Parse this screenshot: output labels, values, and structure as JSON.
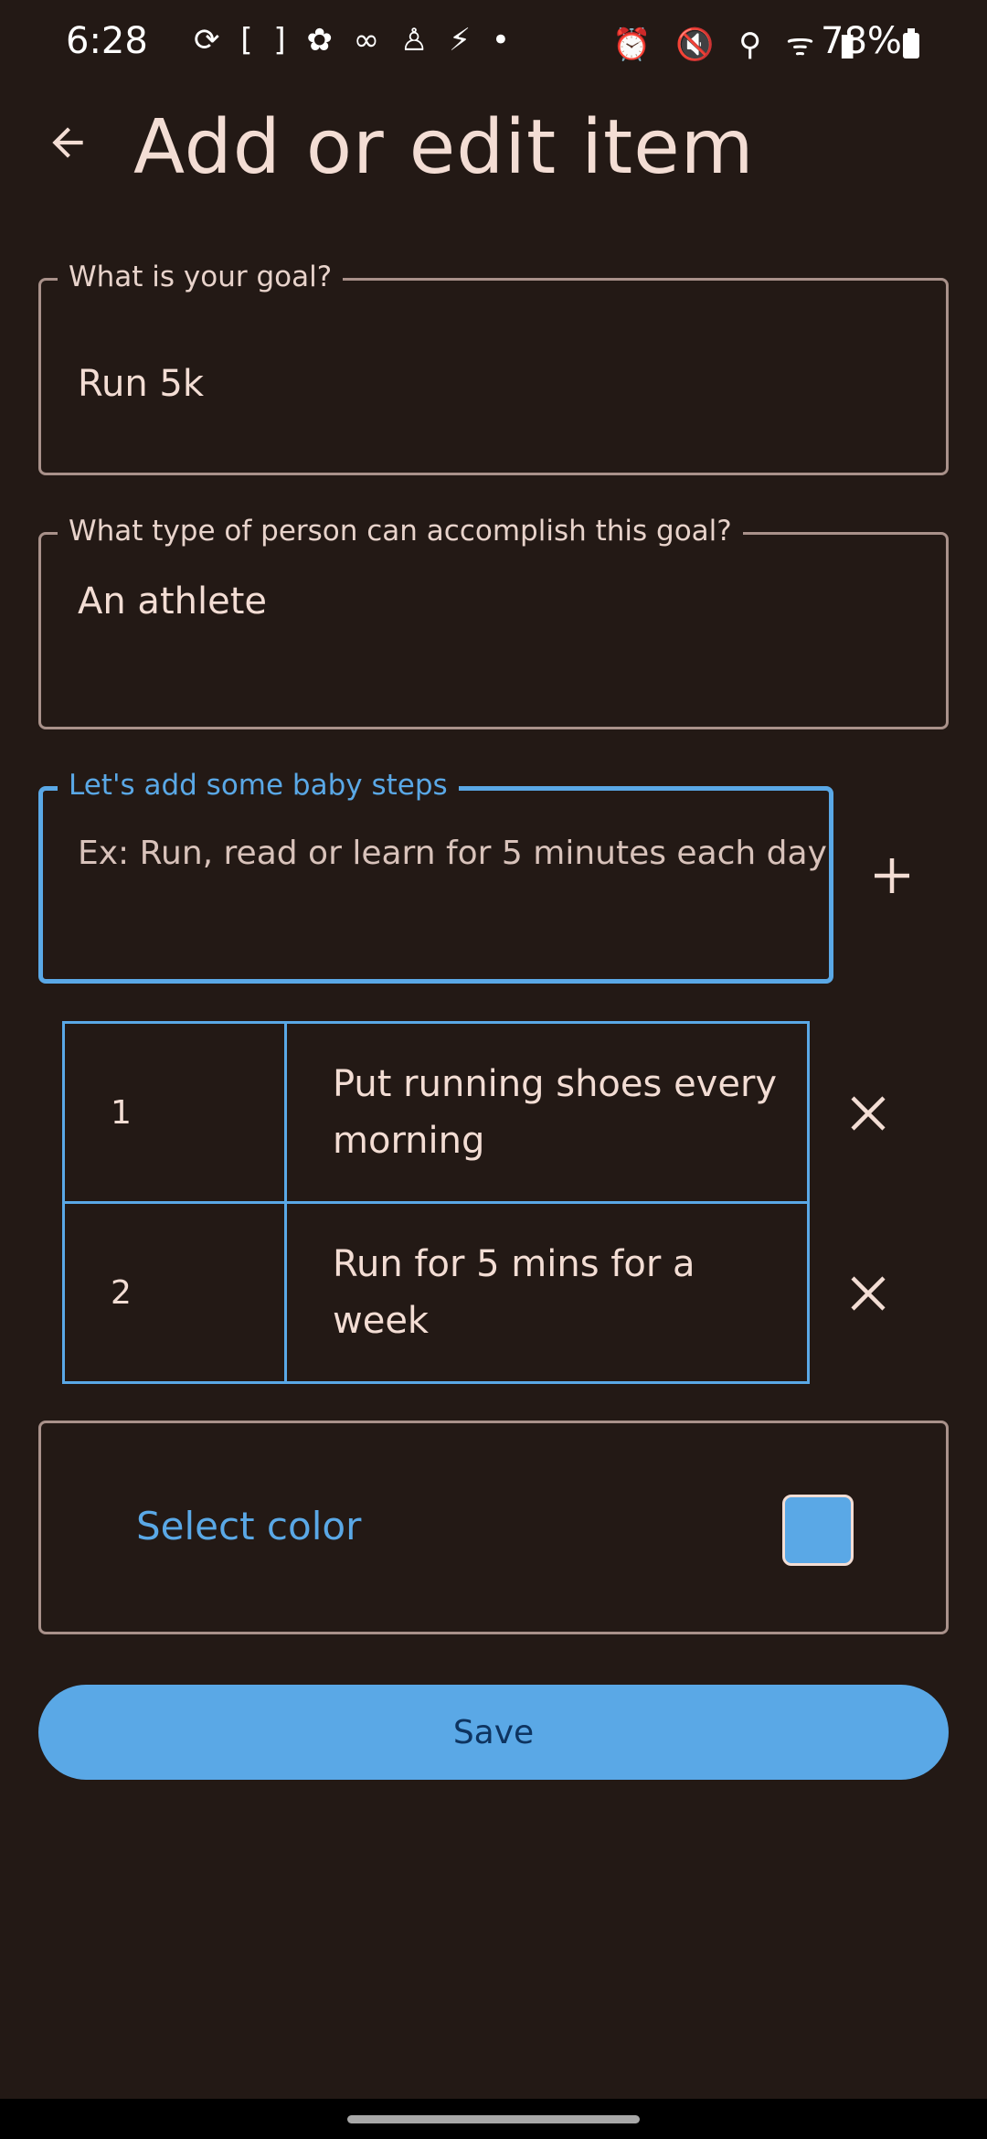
{
  "status_bar": {
    "time": "6:28",
    "left_icons": "⟳ [ ] ✿ ∞ ♙ ⚡ •",
    "right_icons": "⏰ 🔇 ⚲ ᯤ ▮",
    "battery": "78%"
  },
  "header": {
    "title": "Add or edit item"
  },
  "form": {
    "goal": {
      "label": "What is your goal?",
      "value": "Run 5k"
    },
    "identity": {
      "label": "What type of person can accomplish this goal?",
      "value": "An athlete"
    },
    "baby_steps": {
      "label": "Let's add some baby steps",
      "placeholder": "Ex: Run, read or learn for 5 minutes each day"
    }
  },
  "steps": [
    {
      "number": "1",
      "text": "Put running shoes every morning"
    },
    {
      "number": "2",
      "text": "Run for 5 mins for a week"
    }
  ],
  "color_picker": {
    "label": "Select color",
    "selected_color": "#5aa8e6"
  },
  "save_label": "Save",
  "colors": {
    "background": "#231915",
    "accent": "#5aa8e6",
    "text": "#f3ddd4"
  }
}
